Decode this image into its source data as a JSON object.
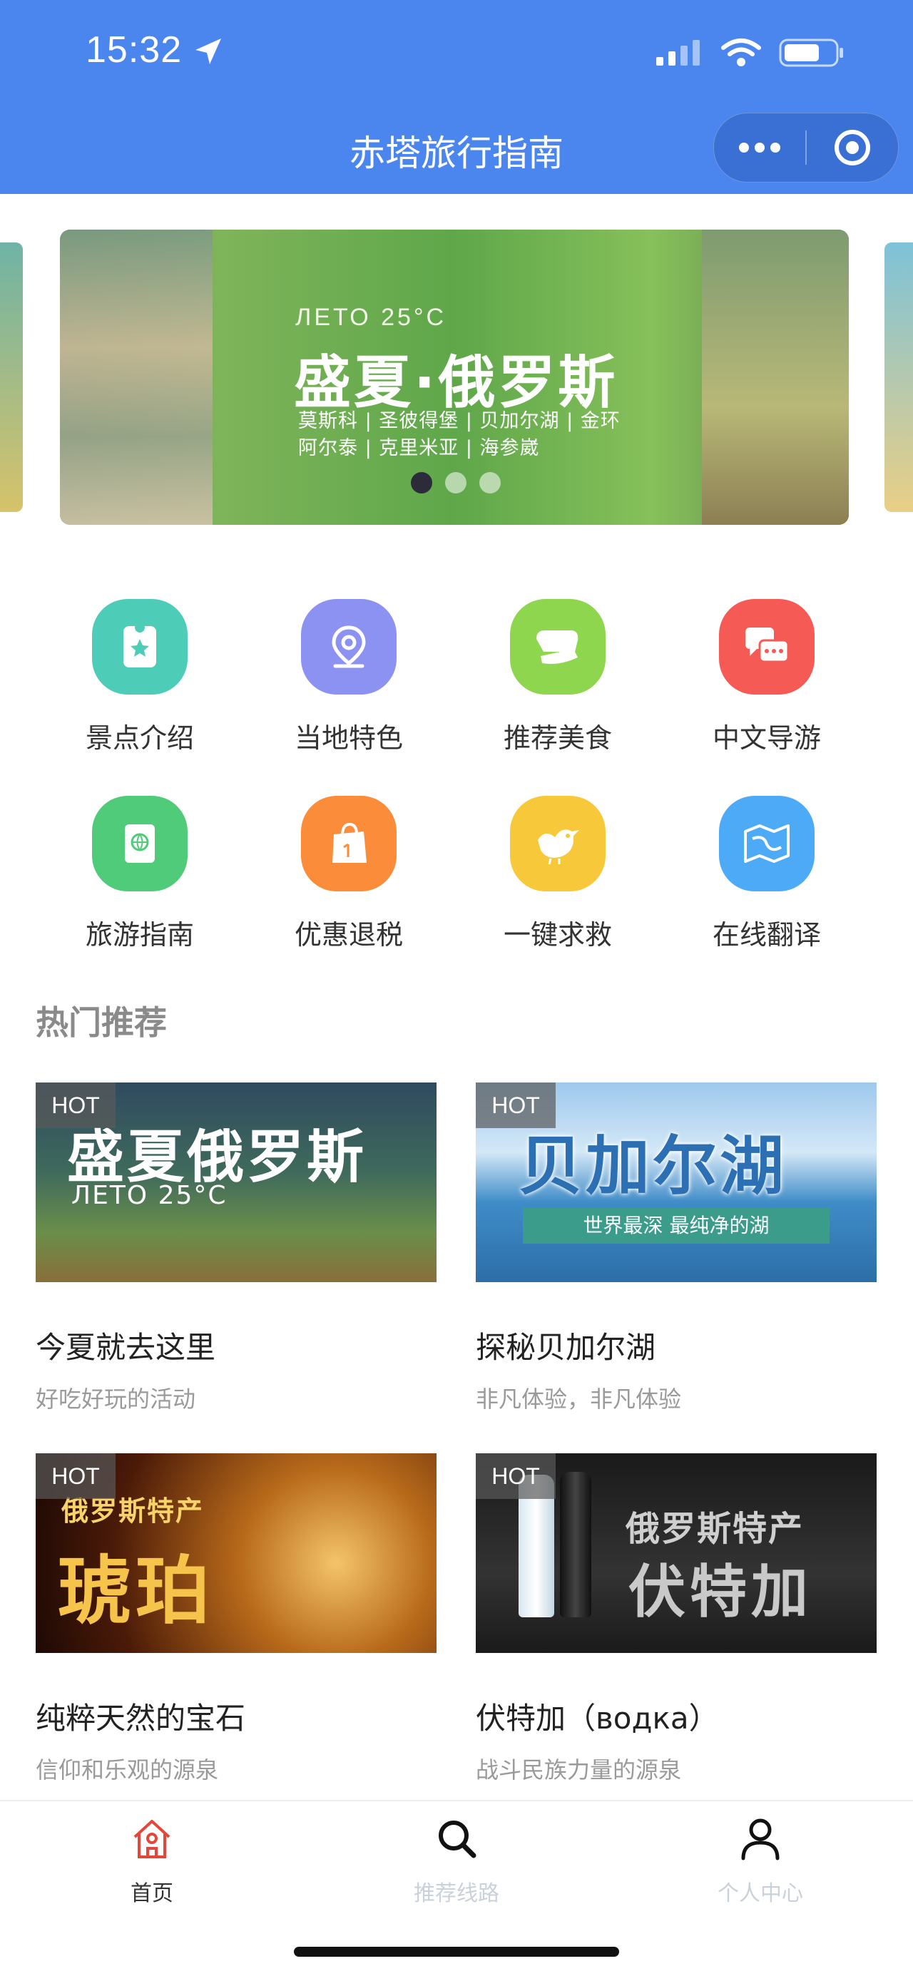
{
  "status_bar": {
    "time": "15:32"
  },
  "nav": {
    "title": "赤塔旅行指南"
  },
  "banner": {
    "leto": "ЛЕТО 25°C",
    "headline": "盛夏·俄罗斯",
    "line1": "莫斯科 | 圣彼得堡 | 贝加尔湖 | 金环",
    "line2": "阿尔泰 | 克里米亚 | 海参崴",
    "active_dot": 1,
    "dot_count": 3
  },
  "features": [
    {
      "label": "景点介绍",
      "icon": "ticket-star-icon",
      "color": "#4dcdb8"
    },
    {
      "label": "当地特色",
      "icon": "location-pin-icon",
      "color": "#8c92f2"
    },
    {
      "label": "推荐美食",
      "icon": "food-icon",
      "color": "#8dd64d"
    },
    {
      "label": "中文导游",
      "icon": "chat-bubbles-icon",
      "color": "#f65a55"
    },
    {
      "label": "旅游指南",
      "icon": "passport-icon",
      "color": "#4fcb79"
    },
    {
      "label": "优惠退税",
      "icon": "shopping-bag-icon",
      "color": "#fb8c3a"
    },
    {
      "label": "一键求救",
      "icon": "bird-icon",
      "color": "#f7c93a"
    },
    {
      "label": "在线翻译",
      "icon": "map-icon",
      "color": "#4daaf7"
    }
  ],
  "section": {
    "title": "热门推荐"
  },
  "cards": [
    {
      "badge": "HOT",
      "img_text": "盛夏俄罗斯",
      "img_sub": "ЛЕТО 25°C",
      "title": "今夏就去这里",
      "subtitle": "好吃好玩的活动"
    },
    {
      "badge": "HOT",
      "img_text": "贝加尔湖",
      "img_sub": "世界最深 最纯净的湖",
      "title": "探秘贝加尔湖",
      "subtitle": "非凡体验，非凡体验"
    },
    {
      "badge": "HOT",
      "img_text": "琥珀",
      "img_sub": "俄罗斯特产",
      "title": "纯粹天然的宝石",
      "subtitle": "信仰和乐观的源泉"
    },
    {
      "badge": "HOT",
      "img_text": "伏特加",
      "img_sub": "俄罗斯特产",
      "title": "伏特加（водка）",
      "subtitle": "战斗民族力量的源泉"
    }
  ],
  "tabbar": {
    "items": [
      {
        "label": "首页",
        "icon": "home-icon",
        "active": true
      },
      {
        "label": "推荐线路",
        "icon": "search-icon",
        "active": false
      },
      {
        "label": "个人中心",
        "icon": "user-icon",
        "active": false
      }
    ],
    "active_color": "#e4463a",
    "inactive_color": "#c9d1da"
  },
  "colors": {
    "primary": "#4a86ee"
  }
}
